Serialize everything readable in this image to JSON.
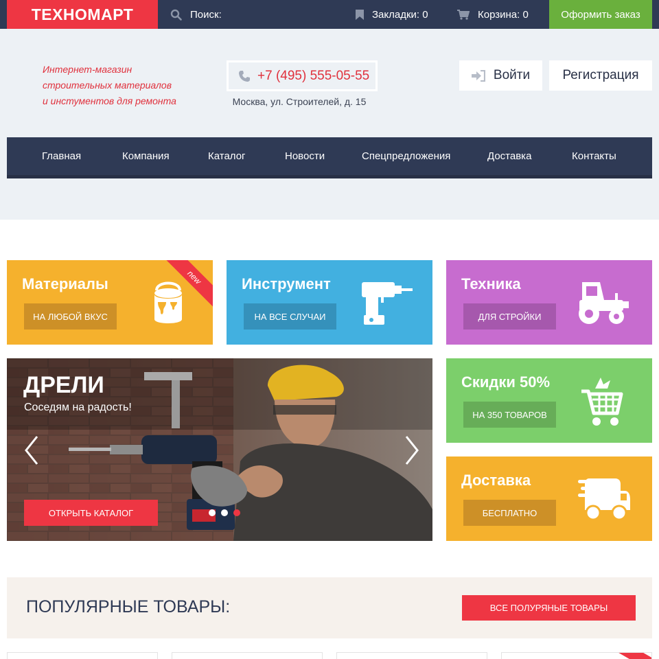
{
  "topbar": {
    "logo": "ТЕХНОМАРТ",
    "search_label": "Поиск:",
    "bookmarks_label": "Закладки: 0",
    "cart_label": "Корзина: 0",
    "order_button": "Оформить заказ",
    "icons": {
      "search": "search-icon",
      "bookmarks": "bookmark-icon",
      "cart": "cart-icon"
    }
  },
  "header": {
    "tagline": [
      "Интернет-магазин",
      "строительных материалов",
      "и инстументов для ремонта"
    ],
    "phone": "+7 (495) 555-05-55",
    "address": "Москва, ул. Строителей, д. 15",
    "login": "Войти",
    "register": "Регистрация"
  },
  "nav": {
    "items": [
      "Главная",
      "Компания",
      "Каталог",
      "Новости",
      "Спецпредложения",
      "Доставка",
      "Контакты"
    ]
  },
  "tiles": {
    "materials": {
      "title": "Материалы",
      "button": "НА ЛЮБОЙ ВКУС",
      "badge": "new",
      "icon": "paint-bucket-icon"
    },
    "tools": {
      "title": "Инструмент",
      "button": "НА ВСЕ СЛУЧАИ",
      "icon": "drill-icon"
    },
    "machines": {
      "title": "Техника",
      "button": "ДЛЯ СТРОЙКИ",
      "icon": "tractor-icon"
    },
    "discount": {
      "title": "Скидки 50%",
      "button": "НА 350 ТОВАРОВ",
      "icon": "shopping-cart-icon"
    },
    "delivery": {
      "title": "Доставка",
      "button": "БЕСПЛАТНО",
      "icon": "truck-icon"
    }
  },
  "slider": {
    "title": "ДРЕЛИ",
    "subtitle": "Соседям на радость!",
    "cta": "ОТКРЫТЬ КАТАЛОГ",
    "slides_count": 3,
    "active_slide": 3
  },
  "popular": {
    "title": "ПОПУЛЯРНЫЕ ТОВАРЫ:",
    "button": "ВСЕ ПОЛУРЯНЫЕ ТОВАРЫ"
  },
  "colors": {
    "navy": "#2f3a55",
    "red": "#ee3643",
    "green": "#6ab03d",
    "yellow": "#f5b12d",
    "blue": "#42b0e0",
    "purple": "#c76ccf",
    "light_green": "#7ccf6b"
  }
}
